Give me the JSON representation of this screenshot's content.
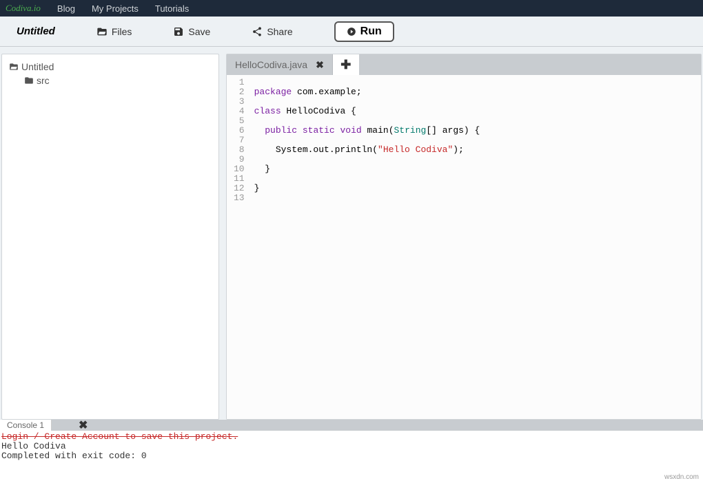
{
  "nav": {
    "brand": "Codiva.io",
    "items": [
      "Blog",
      "My Projects",
      "Tutorials"
    ]
  },
  "toolbar": {
    "title": "Untitled",
    "files": "Files",
    "save": "Save",
    "share": "Share",
    "run": "Run"
  },
  "tree": {
    "root": "Untitled",
    "src": "src"
  },
  "tabs": {
    "active": "HelloCodiva.java"
  },
  "code": {
    "line_numbers": [
      "1",
      "2",
      "3",
      "4",
      "5",
      "6",
      "7",
      "8",
      "9",
      "10",
      "11",
      "12",
      "13"
    ],
    "tokens": [
      [
        {
          "t": "",
          "c": ""
        }
      ],
      [
        {
          "t": "package",
          "c": "kw"
        },
        {
          "t": " com.example;",
          "c": ""
        }
      ],
      [
        {
          "t": "",
          "c": ""
        }
      ],
      [
        {
          "t": "class",
          "c": "kw"
        },
        {
          "t": " HelloCodiva {",
          "c": ""
        }
      ],
      [
        {
          "t": "",
          "c": ""
        }
      ],
      [
        {
          "t": "  ",
          "c": ""
        },
        {
          "t": "public",
          "c": "kw"
        },
        {
          "t": " ",
          "c": ""
        },
        {
          "t": "static",
          "c": "kw"
        },
        {
          "t": " ",
          "c": ""
        },
        {
          "t": "void",
          "c": "kw"
        },
        {
          "t": " main(",
          "c": ""
        },
        {
          "t": "String",
          "c": "type"
        },
        {
          "t": "[] args) {",
          "c": ""
        }
      ],
      [
        {
          "t": "",
          "c": ""
        }
      ],
      [
        {
          "t": "    System.out.println(",
          "c": ""
        },
        {
          "t": "\"Hello Codiva\"",
          "c": "str"
        },
        {
          "t": ");",
          "c": ""
        }
      ],
      [
        {
          "t": "",
          "c": ""
        }
      ],
      [
        {
          "t": "  }",
          "c": ""
        }
      ],
      [
        {
          "t": "",
          "c": ""
        }
      ],
      [
        {
          "t": "}",
          "c": ""
        }
      ],
      [
        {
          "t": "",
          "c": ""
        }
      ]
    ]
  },
  "console": {
    "tab": "Console 1",
    "line1": "Login / Create Account to save this project.",
    "line2": "Hello Codiva",
    "line3": "",
    "line4": "Completed with exit code: 0"
  },
  "watermark": "wsxdn.com"
}
